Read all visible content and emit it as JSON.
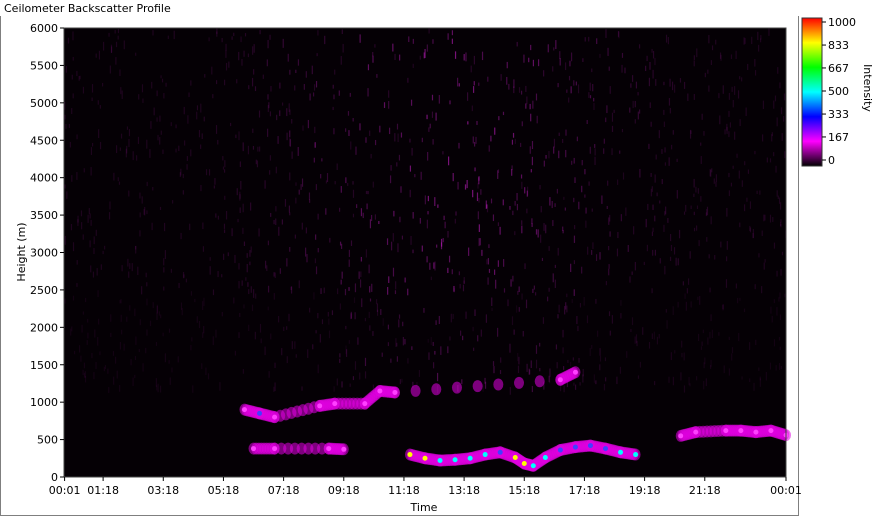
{
  "window": {
    "title": "Ceilometer Backscatter Profile"
  },
  "chart_data": {
    "type": "heatmap",
    "title": "",
    "xlabel": "Time",
    "ylabel": "Height (m)",
    "x_tick_labels": [
      "00:01",
      "01:18",
      "03:18",
      "05:18",
      "07:18",
      "09:18",
      "11:18",
      "13:18",
      "15:18",
      "17:18",
      "19:18",
      "21:18",
      "00:01"
    ],
    "x_tick_hours": [
      0.02,
      1.3,
      3.3,
      5.3,
      7.3,
      9.3,
      11.3,
      13.3,
      15.3,
      17.3,
      19.3,
      21.3,
      24.0
    ],
    "x_range_hours": [
      0,
      24
    ],
    "y_ticks": [
      0,
      500,
      1000,
      1500,
      2000,
      2500,
      3000,
      3500,
      4000,
      4500,
      5000,
      5500,
      6000
    ],
    "ylim": [
      0,
      6000
    ],
    "colorbar": {
      "label": "Intensity",
      "ticks": [
        1000,
        833,
        667,
        500,
        333,
        167,
        0
      ],
      "range": [
        0,
        1000
      ],
      "colors": [
        "#000000",
        "#ff00ff",
        "#0000ff",
        "#00ffff",
        "#00ff00",
        "#ffff00",
        "#ff0000"
      ]
    },
    "features": [
      {
        "name": "aerosol-layer",
        "points": [
          [
            11.5,
            300,
            420
          ],
          [
            12.0,
            250,
            480
          ],
          [
            12.5,
            220,
            300
          ],
          [
            13.0,
            230,
            280
          ],
          [
            13.5,
            250,
            270
          ],
          [
            14.0,
            300,
            260
          ],
          [
            14.5,
            330,
            200
          ],
          [
            15.0,
            260,
            450
          ],
          [
            15.3,
            180,
            500
          ],
          [
            15.6,
            150,
            330
          ],
          [
            16.0,
            260,
            300
          ],
          [
            16.5,
            360,
            230
          ],
          [
            17.0,
            400,
            220
          ],
          [
            17.5,
            420,
            210
          ],
          [
            18.0,
            380,
            250
          ],
          [
            18.5,
            330,
            320
          ],
          [
            19.0,
            300,
            260
          ]
        ]
      },
      {
        "name": "residual-layer",
        "points": [
          [
            6.3,
            380,
            160
          ],
          [
            7.0,
            380,
            150
          ],
          [
            8.8,
            380,
            140
          ],
          [
            9.3,
            370,
            130
          ]
        ]
      },
      {
        "name": "upper-layer",
        "points": [
          [
            6.0,
            900,
            180
          ],
          [
            6.5,
            850,
            200
          ],
          [
            7.0,
            800,
            160
          ],
          [
            8.5,
            950,
            160
          ],
          [
            9.0,
            980,
            160
          ],
          [
            10.0,
            980,
            150
          ],
          [
            10.5,
            1150,
            160
          ],
          [
            11.0,
            1130,
            150
          ],
          [
            16.5,
            1300,
            130
          ],
          [
            17.0,
            1400,
            110
          ]
        ]
      },
      {
        "name": "evening-layer",
        "points": [
          [
            20.5,
            550,
            150
          ],
          [
            21.0,
            600,
            130
          ],
          [
            22.0,
            620,
            150
          ],
          [
            22.5,
            620,
            120
          ],
          [
            23.0,
            600,
            160
          ],
          [
            23.5,
            620,
            160
          ],
          [
            24.0,
            560,
            120
          ]
        ]
      }
    ],
    "legend": "right"
  }
}
